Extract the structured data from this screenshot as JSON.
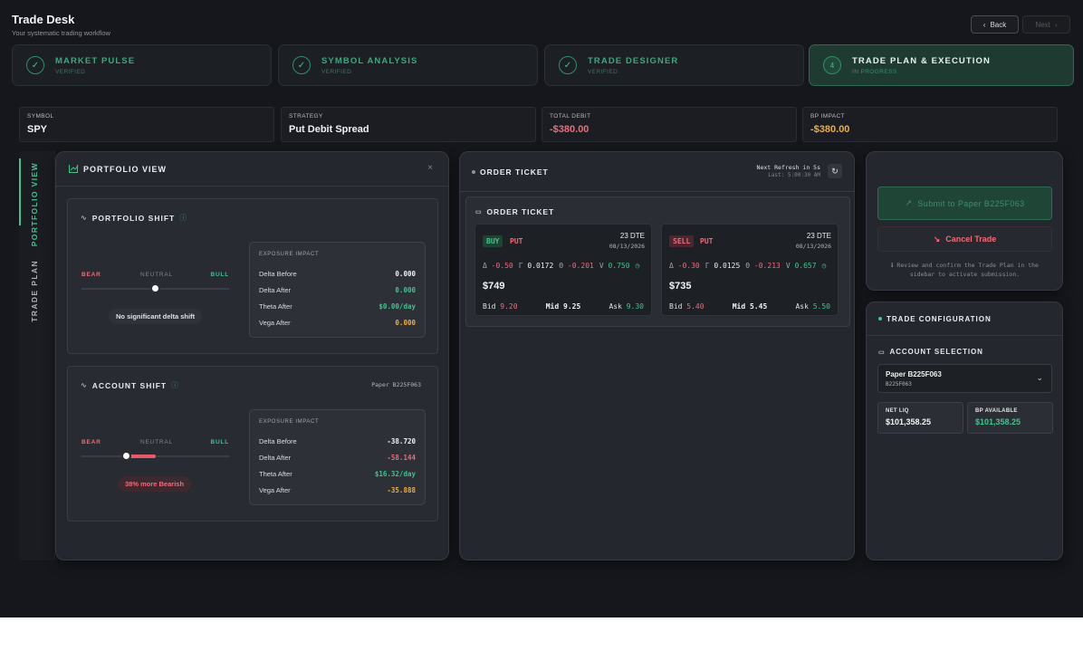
{
  "header": {
    "title": "Trade Desk",
    "subtitle": "Your systematic trading workflow",
    "back_label": "Back",
    "next_label": "Next"
  },
  "steps": [
    {
      "name": "MARKET PULSE",
      "status": "VERIFIED",
      "state": "done"
    },
    {
      "name": "SYMBOL ANALYSIS",
      "status": "VERIFIED",
      "state": "done"
    },
    {
      "name": "TRADE DESIGNER",
      "status": "VERIFIED",
      "state": "done"
    },
    {
      "name": "TRADE PLAN & EXECUTION",
      "status": "IN PROGRESS",
      "state": "active",
      "number": "4"
    }
  ],
  "summary": [
    {
      "label": "SYMBOL",
      "value": "SPY"
    },
    {
      "label": "STRATEGY",
      "value": "Put Debit Spread"
    },
    {
      "label": "TOTAL DEBIT",
      "value": "-$380.00"
    },
    {
      "label": "BP IMPACT",
      "value": "-$380.00"
    }
  ],
  "vtabs": {
    "portfolio": "PORTFOLIO VIEW",
    "plan": "TRADE PLAN"
  },
  "portfolio": {
    "title": "PORTFOLIO VIEW",
    "shift": {
      "title": "PORTFOLIO SHIFT",
      "bear": "BEAR",
      "neutral": "NEUTRAL",
      "bull": "BULL",
      "pill": "No significant delta shift",
      "exposure_label": "EXPOSURE IMPACT",
      "rows": [
        {
          "label": "Delta Before",
          "value": "0.000"
        },
        {
          "label": "Delta After",
          "value": "0.000"
        },
        {
          "label": "Theta After",
          "value": "$0.00/day"
        },
        {
          "label": "Vega After",
          "value": "0.000"
        }
      ]
    },
    "account": {
      "title": "ACCOUNT SHIFT",
      "account_name": "Paper B225F063",
      "bear": "BEAR",
      "neutral": "NEUTRAL",
      "bull": "BULL",
      "pill": "38% more Bearish",
      "exposure_label": "EXPOSURE IMPACT",
      "rows": [
        {
          "label": "Delta Before",
          "value": "-38.720"
        },
        {
          "label": "Delta After",
          "value": "-58.144"
        },
        {
          "label": "Theta After",
          "value": "$16.32/day"
        },
        {
          "label": "Vega After",
          "value": "-35.888"
        }
      ]
    }
  },
  "order": {
    "title": "ORDER TICKET",
    "refresh": "Next Refresh in 5s",
    "last": "Last: 5:00:30 AM",
    "inner_title": "ORDER TICKET",
    "legs": [
      {
        "side": "BUY",
        "type": "PUT",
        "dte": "23 DTE",
        "date": "08/13/2026",
        "delta": "-0.50",
        "gamma": "0.0172",
        "theta": "-0.201",
        "vega": "0.750",
        "price": "$749",
        "bid_label": "Bid",
        "bid": "9.20",
        "mid_label": "Mid",
        "mid": "9.25",
        "ask_label": "Ask",
        "ask": "9.30"
      },
      {
        "side": "SELL",
        "type": "PUT",
        "dte": "23 DTE",
        "date": "08/13/2026",
        "delta": "-0.30",
        "gamma": "0.0125",
        "theta": "-0.213",
        "vega": "0.657",
        "price": "$735",
        "bid_label": "Bid",
        "bid": "5.40",
        "mid_label": "Mid",
        "mid": "5.45",
        "ask_label": "Ask",
        "ask": "5.50"
      }
    ]
  },
  "actions": {
    "submit": "Submit to Paper B225F063",
    "cancel": "Cancel Trade",
    "note": "Review and confirm the Trade Plan in the sidebar to activate submission."
  },
  "config": {
    "title": "TRADE CONFIGURATION",
    "section": "ACCOUNT SELECTION",
    "account_name": "Paper B225F063",
    "account_id": "B225F063",
    "net_liq_label": "NET LIQ",
    "net_liq": "$101,358.25",
    "bp_label": "BP AVAILABLE",
    "bp": "$101,358.25"
  },
  "colors": {
    "accent": "#3fc48f",
    "negative": "#ef6b7a",
    "warning": "#f1ad3c",
    "background": "#15171c"
  }
}
